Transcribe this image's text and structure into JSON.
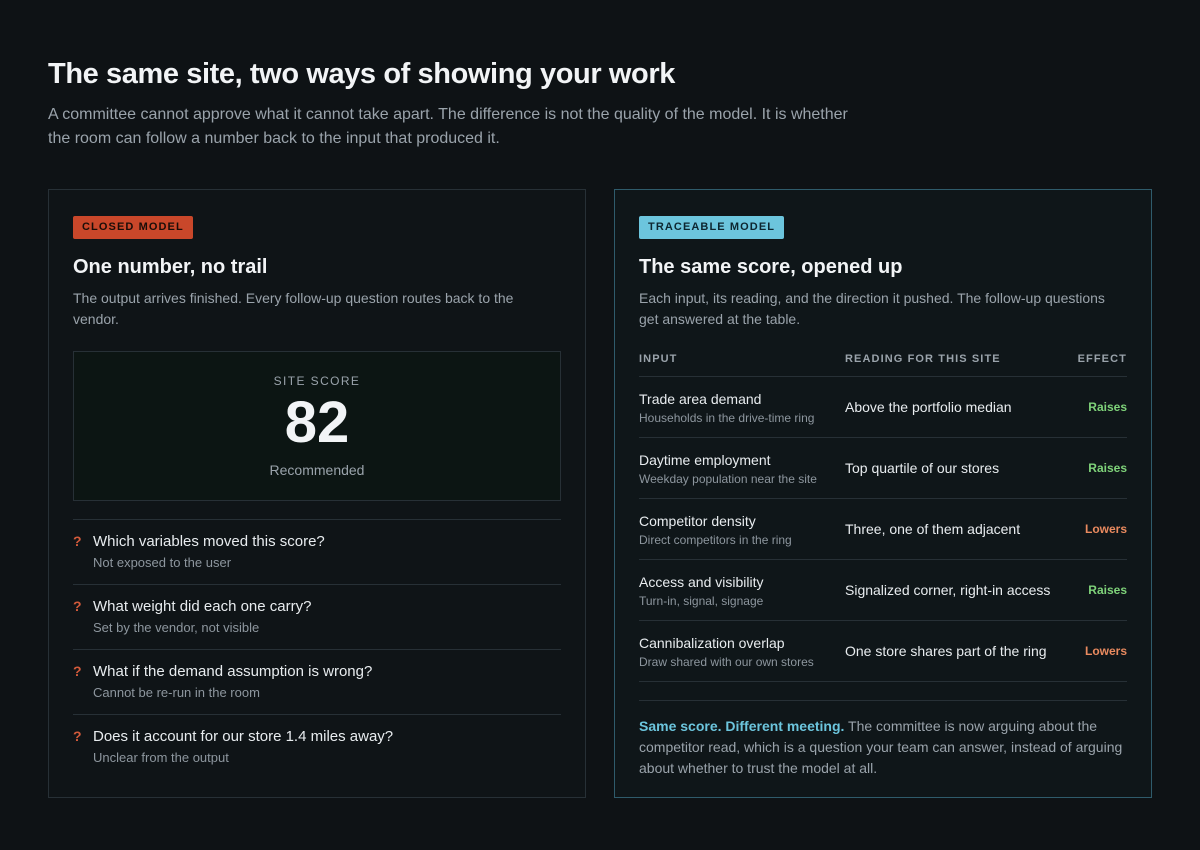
{
  "header": {
    "title": "The same site, two ways of showing your work",
    "subtitle": "A committee cannot approve what it cannot take apart. The difference is not the quality of the model. It is whether the room can follow a number back to the input that produced it."
  },
  "closed": {
    "tag": "CLOSED MODEL",
    "title": "One number, no trail",
    "subtitle": "The output arrives finished. Every follow-up question routes back to the vendor.",
    "score_label": "SITE SCORE",
    "score_value": "82",
    "score_note": "Recommended",
    "question_mark": "?",
    "questions": [
      {
        "q": "Which variables moved this score?",
        "a": "Not exposed to the user"
      },
      {
        "q": "What weight did each one carry?",
        "a": "Set by the vendor, not visible"
      },
      {
        "q": "What if the demand assumption is wrong?",
        "a": "Cannot be re-run in the room"
      },
      {
        "q": "Does it account for our store 1.4 miles away?",
        "a": "Unclear from the output"
      }
    ]
  },
  "traceable": {
    "tag": "TRACEABLE MODEL",
    "title": "The same score, opened up",
    "subtitle": "Each input, its reading, and the direction it pushed. The follow-up questions get answered at the table.",
    "columns": {
      "input": "INPUT",
      "reading": "READING FOR THIS SITE",
      "effect": "EFFECT"
    },
    "rows": [
      {
        "title": "Trade area demand",
        "sub": "Households in the drive-time ring",
        "reading": "Above the portfolio median",
        "effect": "Raises"
      },
      {
        "title": "Daytime employment",
        "sub": "Weekday population near the site",
        "reading": "Top quartile of our stores",
        "effect": "Raises"
      },
      {
        "title": "Competitor density",
        "sub": "Direct competitors in the ring",
        "reading": "Three, one of them adjacent",
        "effect": "Lowers"
      },
      {
        "title": "Access and visibility",
        "sub": "Turn-in, signal, signage",
        "reading": "Signalized corner, right-in access",
        "effect": "Raises"
      },
      {
        "title": "Cannibalization overlap",
        "sub": "Draw shared with our own stores",
        "reading": "One store shares part of the ring",
        "effect": "Lowers"
      }
    ],
    "footer_highlight": "Same score. Different meeting.",
    "footer_text": " The committee is now arguing about the competitor read, which is a question your team can answer, instead of arguing about whether to trust the model at all."
  },
  "colors": {
    "background": "#0e1215",
    "closed_accent": "#c9472a",
    "trace_accent": "#6cc5dd",
    "raises": "#7fd37a",
    "lowers": "#e98a5f"
  }
}
